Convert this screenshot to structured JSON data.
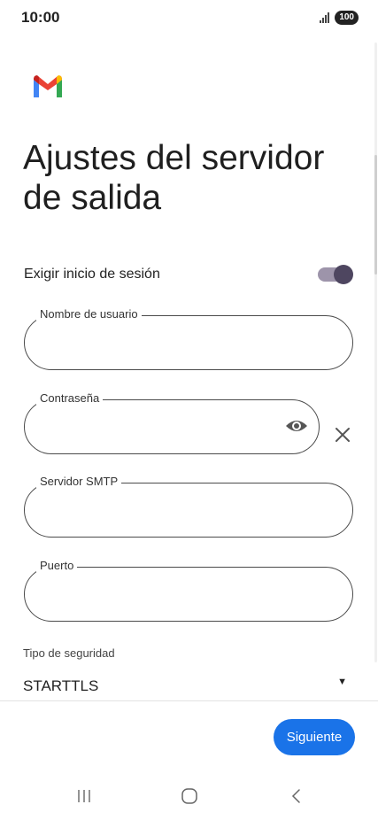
{
  "status_bar": {
    "time": "10:00",
    "battery": "100"
  },
  "header": {
    "title": "Ajustes del servidor de salida"
  },
  "login_required": {
    "label": "Exigir inicio de sesión",
    "enabled": true
  },
  "fields": {
    "username": {
      "label": "Nombre de usuario",
      "value": ""
    },
    "password": {
      "label": "Contraseña",
      "value": ""
    },
    "smtp_server": {
      "label": "Servidor SMTP",
      "value": ""
    },
    "port": {
      "label": "Puerto",
      "value": ""
    }
  },
  "security": {
    "label": "Tipo de seguridad",
    "value": "STARTTLS"
  },
  "footer": {
    "next_label": "Siguiente"
  },
  "colors": {
    "accent": "#1a73e8",
    "toggle_thumb": "#4e4660",
    "toggle_track": "#9d94aa"
  },
  "icons": [
    "gmail-logo-icon",
    "eye-icon",
    "close-icon",
    "dropdown-arrow-icon",
    "nav-recents-icon",
    "nav-home-icon",
    "nav-back-icon"
  ]
}
